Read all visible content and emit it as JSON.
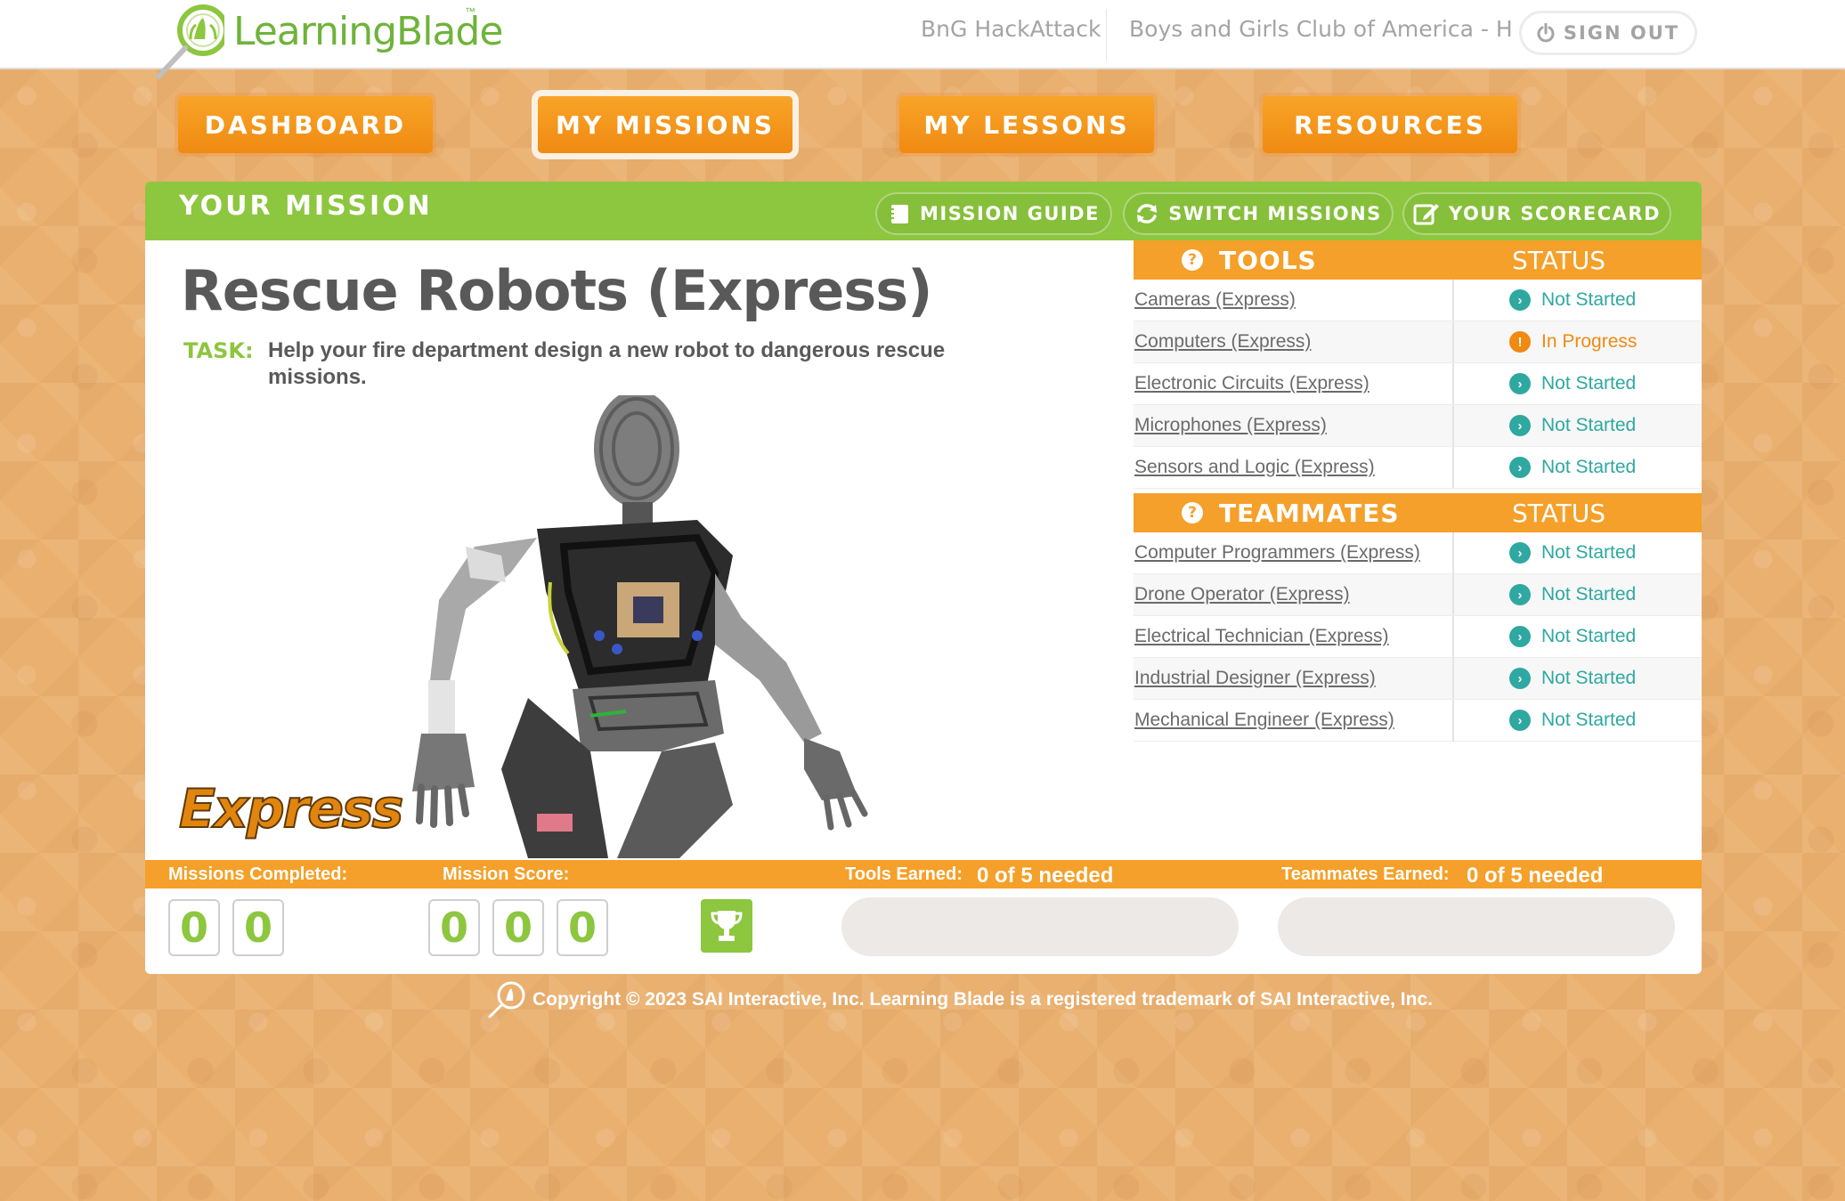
{
  "header": {
    "logo_text": "LearningBlade",
    "logo_tm": "™",
    "group_link": "BnG HackAttack",
    "org_link": "Boys and Girls Club of America - H",
    "signout_label": "SIGN OUT"
  },
  "nav": {
    "dashboard": "DASHBOARD",
    "my_missions": "MY MISSIONS",
    "my_lessons": "MY LESSONS",
    "resources": "RESOURCES",
    "active": "MY MISSIONS"
  },
  "mission_bar": {
    "title": "YOUR MISSION",
    "mission_guide": "MISSION GUIDE",
    "switch_missions": "SWITCH MISSIONS",
    "your_scorecard": "YOUR SCORECARD"
  },
  "mission": {
    "title": "Rescue Robots (Express)",
    "task_label": "TASK:",
    "task_text": "Help your fire department design a new robot to dangerous rescue missions.",
    "badge": "Express"
  },
  "tools": {
    "header": "TOOLS",
    "status_header": "STATUS",
    "rows": [
      {
        "name": "Cameras (Express)",
        "status": "Not Started"
      },
      {
        "name": "Computers (Express)",
        "status": "In Progress"
      },
      {
        "name": "Electronic Circuits (Express)",
        "status": "Not Started"
      },
      {
        "name": "Microphones (Express)",
        "status": "Not Started"
      },
      {
        "name": "Sensors and Logic (Express)",
        "status": "Not Started"
      }
    ]
  },
  "teammates": {
    "header": "TEAMMATES",
    "status_header": "STATUS",
    "rows": [
      {
        "name": "Computer Programmers (Express)",
        "status": "Not Started"
      },
      {
        "name": "Drone Operator (Express)",
        "status": "Not Started"
      },
      {
        "name": "Electrical Technician (Express)",
        "status": "Not Started"
      },
      {
        "name": "Industrial Designer (Express)",
        "status": "Not Started"
      },
      {
        "name": "Mechanical Engineer (Express)",
        "status": "Not Started"
      }
    ]
  },
  "stats": {
    "missions_completed_label": "Missions Completed:",
    "missions_completed_digits": [
      "0",
      "0"
    ],
    "mission_score_label": "Mission Score:",
    "mission_score_digits": [
      "0",
      "0",
      "0"
    ],
    "tools_earned_label": "Tools Earned:",
    "tools_earned_value": "0 of 5 needed",
    "tools_earned_fraction": 0,
    "teammates_earned_label": "Teammates Earned:",
    "teammates_earned_value": "0 of 5 needed",
    "teammates_earned_fraction": 0
  },
  "footer": {
    "copyright": "Copyright © 2023 SAI Interactive, Inc. Learning Blade is a registered trademark of SAI Interactive, Inc."
  },
  "colors": {
    "brand_green": "#8dc63f",
    "brand_orange": "#f5a02a",
    "status_teal": "#2ea8a0",
    "status_orange": "#f08a12"
  }
}
